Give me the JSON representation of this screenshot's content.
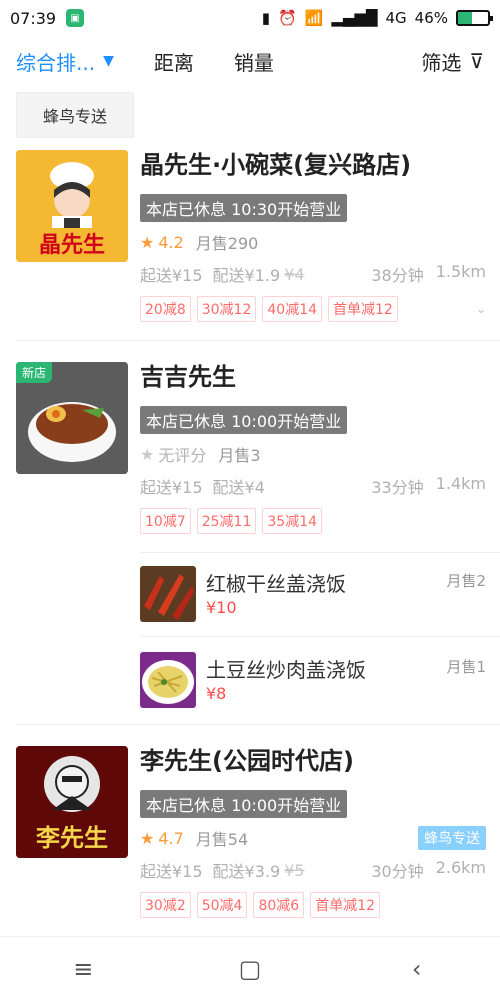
{
  "status_bar": {
    "time": "07:39",
    "network": "4G",
    "battery_percent": "46%",
    "battery_level": 0.46,
    "icons": [
      "vibrate-icon",
      "alarm-icon",
      "wifi-icon",
      "signal-icon"
    ]
  },
  "sort_bar": {
    "comprehensive": "综合排...",
    "distance": "距离",
    "sales": "销量",
    "filter": "筛选"
  },
  "chip": {
    "label": "蜂鸟专送"
  },
  "shops": [
    {
      "name": "晶先生·小碗菜(复兴路店)",
      "status": "本店已休息 10:30开始营业",
      "rating": "4.2",
      "monthly": "月售290",
      "min_order": "起送¥15",
      "delivery_fee": "配送¥1.9",
      "delivery_fee_original": "¥4",
      "time": "38分钟",
      "distance": "1.5km",
      "tags": [
        "20减8",
        "30减12",
        "40减14",
        "首单减12"
      ],
      "logo_text": "晶先生"
    },
    {
      "name": "吉吉先生",
      "status": "本店已休息 10:00开始营业",
      "rating": "无评分",
      "monthly": "月售3",
      "min_order": "起送¥15",
      "delivery_fee": "配送¥4",
      "time": "33分钟",
      "distance": "1.4km",
      "tags": [
        "10减7",
        "25减11",
        "35减14"
      ],
      "badge": "新店",
      "dishes": [
        {
          "name": "红椒干丝盖浇饭",
          "price": "¥10",
          "sales": "月售2"
        },
        {
          "name": "土豆丝炒肉盖浇饭",
          "price": "¥8",
          "sales": "月售1"
        }
      ]
    },
    {
      "name": "李先生(公园时代店)",
      "status": "本店已休息 10:00开始营业",
      "rating": "4.7",
      "monthly": "月售54",
      "fengniao": "蜂鸟专送",
      "min_order": "起送¥15",
      "delivery_fee": "配送¥3.9",
      "delivery_fee_original": "¥5",
      "time": "30分钟",
      "distance": "2.6km",
      "tags": [
        "30减2",
        "50减4",
        "80减6",
        "首单减12"
      ],
      "logo_text": "李先生"
    }
  ],
  "nav": {
    "icons": [
      "menu-icon",
      "home-icon",
      "back-icon"
    ]
  }
}
